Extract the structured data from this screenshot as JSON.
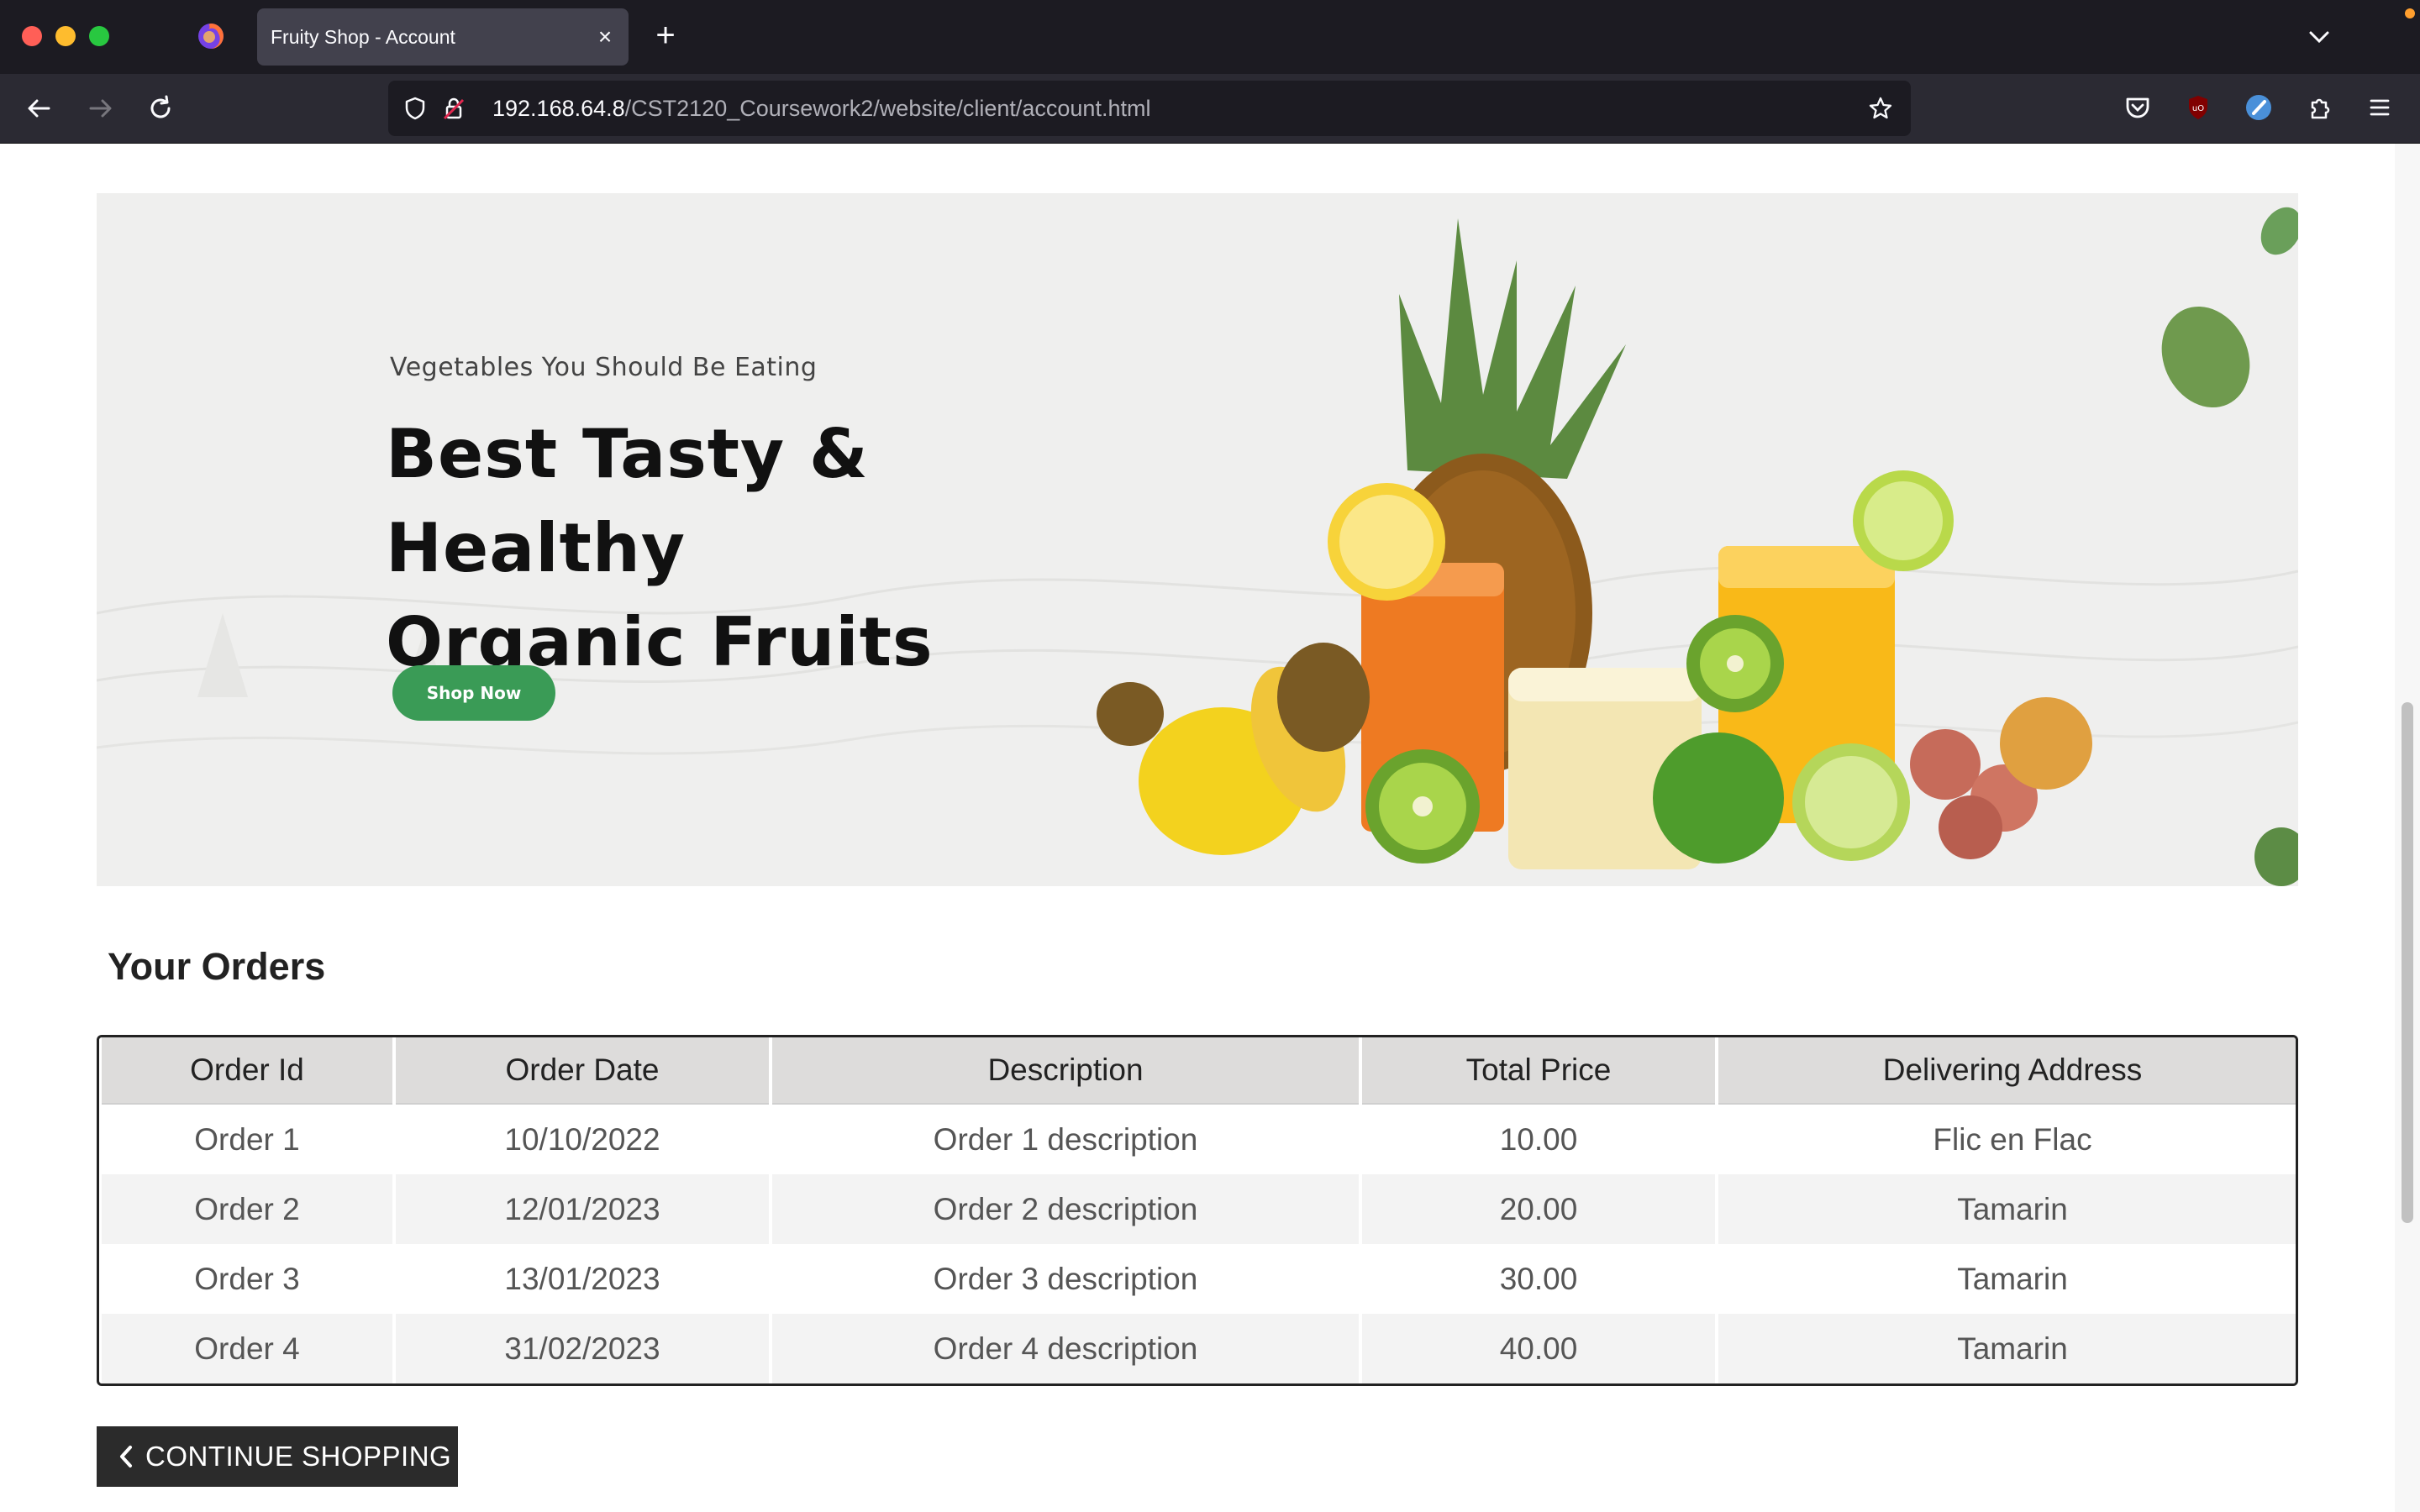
{
  "browser": {
    "tab_title": "Fruity Shop - Account",
    "tab_close_glyph": "×",
    "new_tab_glyph": "+",
    "url_host": "192.168.64.8",
    "url_path": "/CST2120_Coursework2/website/client/account.html"
  },
  "hero": {
    "subtitle": "Vegetables You Should Be Eating",
    "title_line1": "Best Tasty & Healthy",
    "title_line2": "Organic Fruits",
    "button_label": "Shop Now"
  },
  "orders": {
    "heading": "Your Orders",
    "columns": [
      "Order Id",
      "Order Date",
      "Description",
      "Total Price",
      "Delivering Address"
    ],
    "rows": [
      [
        "Order 1",
        "10/10/2022",
        "Order 1 description",
        "10.00",
        "Flic en Flac"
      ],
      [
        "Order 2",
        "12/01/2023",
        "Order 2 description",
        "20.00",
        "Tamarin"
      ],
      [
        "Order 3",
        "13/01/2023",
        "Order 3 description",
        "30.00",
        "Tamarin"
      ],
      [
        "Order 4",
        "31/02/2023",
        "Order 4 description",
        "40.00",
        "Tamarin"
      ]
    ]
  },
  "continue_button": {
    "label": "CONTINUE SHOPPING"
  },
  "colors": {
    "hero_button": "#3a9b56",
    "table_header": "#dddcdb",
    "continue_button": "#2b2b2b"
  },
  "icons": [
    "firefox-icon",
    "back-icon",
    "forward-icon",
    "reload-icon",
    "shield-icon",
    "insecure-lock-icon",
    "bookmark-star-icon",
    "pocket-icon",
    "ublock-icon",
    "extension-blue-icon",
    "extensions-icon",
    "menu-icon",
    "tab-list-icon",
    "chevron-left-icon"
  ]
}
